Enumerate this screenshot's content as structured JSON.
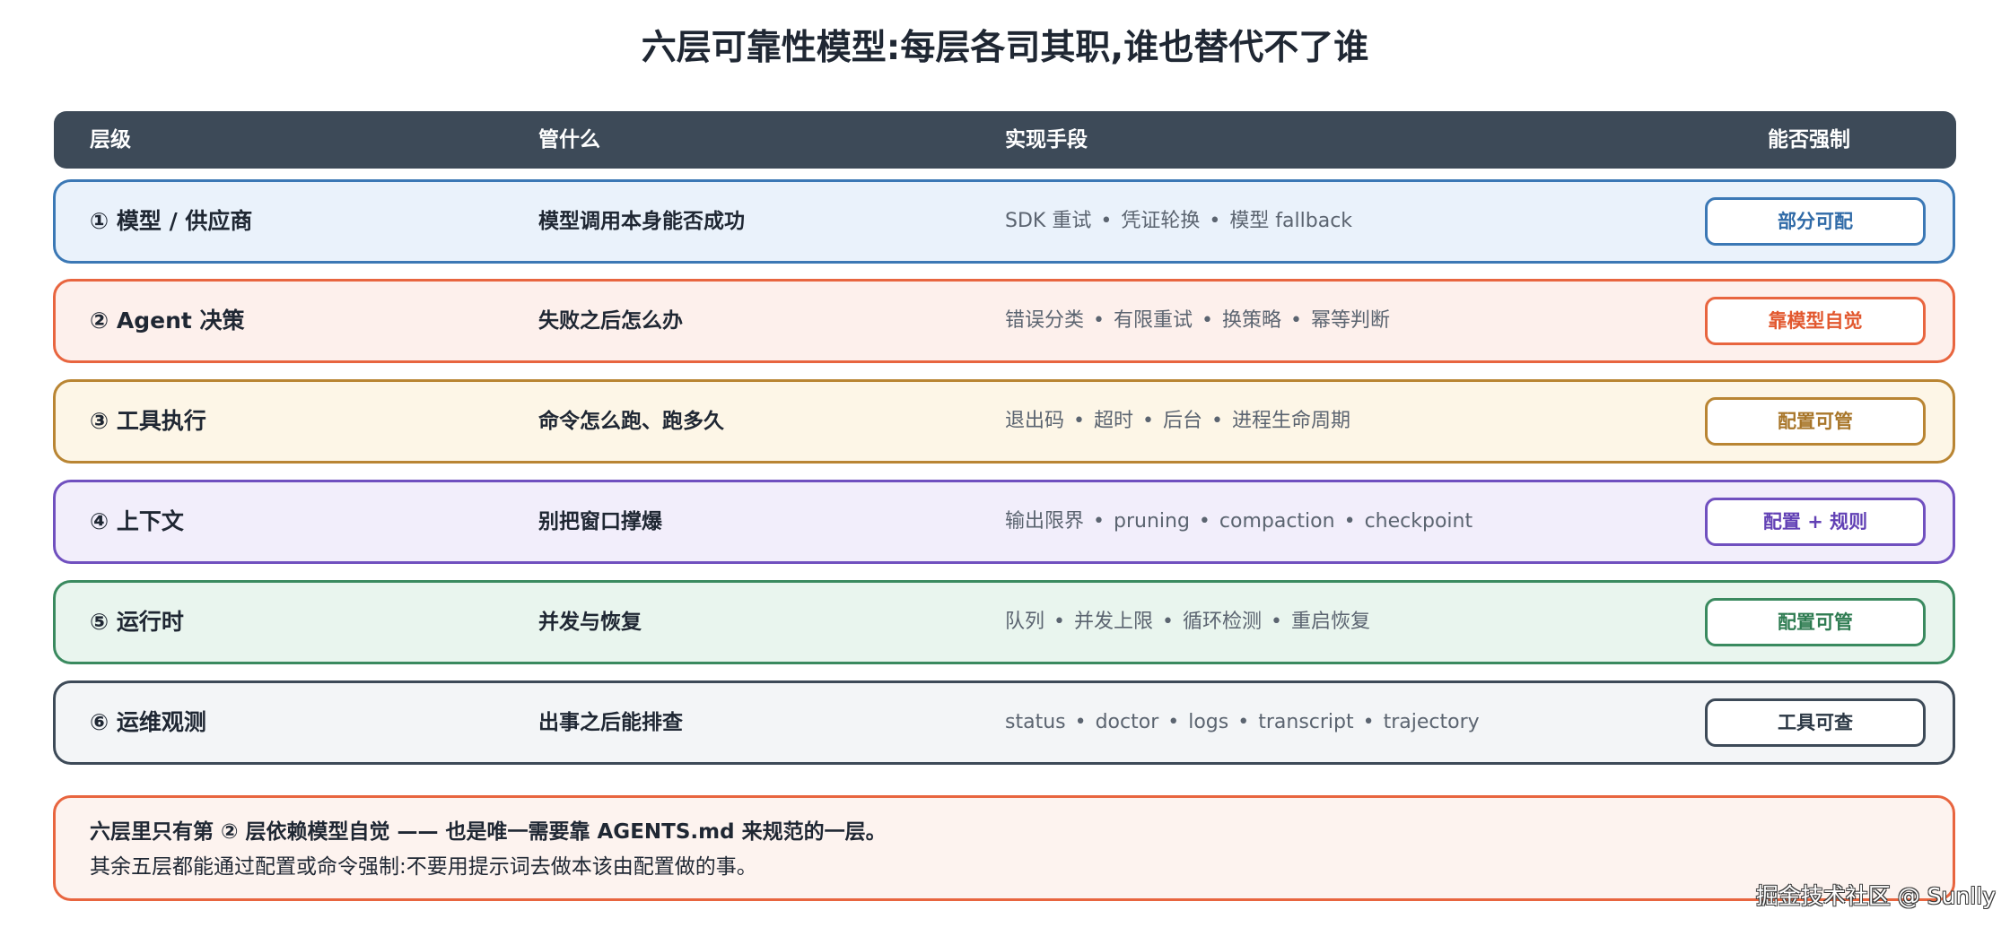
{
  "title": "六层可靠性模型:每层各司其职,谁也替代不了谁",
  "header": {
    "layer": "层级",
    "scope": "管什么",
    "means": "实现手段",
    "enforce": "能否强制"
  },
  "rows": [
    {
      "layer": "① 模型 / 供应商",
      "scope": "模型调用本身能否成功",
      "means": [
        "SDK 重试",
        "凭证轮换",
        "模型 fallback"
      ],
      "enforce": "部分可配",
      "color": "#3b78b5"
    },
    {
      "layer": "② Agent 决策",
      "scope": "失败之后怎么办",
      "means": [
        "错误分类",
        "有限重试",
        "换策略",
        "幂等判断"
      ],
      "enforce": "靠模型自觉",
      "color": "#e8653f"
    },
    {
      "layer": "③ 工具执行",
      "scope": "命令怎么跑、跑多久",
      "means": [
        "退出码",
        "超时",
        "后台",
        "进程生命周期"
      ],
      "enforce": "配置可管",
      "color": "#b98533"
    },
    {
      "layer": "④ 上下文",
      "scope": "别把窗口撑爆",
      "means": [
        "输出限界",
        "pruning",
        "compaction",
        "checkpoint"
      ],
      "enforce": "配置 + 规则",
      "color": "#7050bf"
    },
    {
      "layer": "⑤ 运行时",
      "scope": "并发与恢复",
      "means": [
        "队列",
        "并发上限",
        "循环检测",
        "重启恢复"
      ],
      "enforce": "配置可管",
      "color": "#3a8a5f"
    },
    {
      "layer": "⑥ 运维观测",
      "scope": "出事之后能排查",
      "means": [
        "status",
        "doctor",
        "logs",
        "transcript",
        "trajectory"
      ],
      "enforce": "工具可查",
      "color": "#3d4a58"
    }
  ],
  "note": {
    "line1": "六层里只有第 ② 层依赖模型自觉 —— 也是唯一需要靠 AGENTS.md 来规范的一层。",
    "line2": "其余五层都能通过配置或命令强制:不要用提示词去做本该由配置做的事。"
  },
  "watermark": "掘金技术社区 @ Sunlly",
  "separator": "•"
}
